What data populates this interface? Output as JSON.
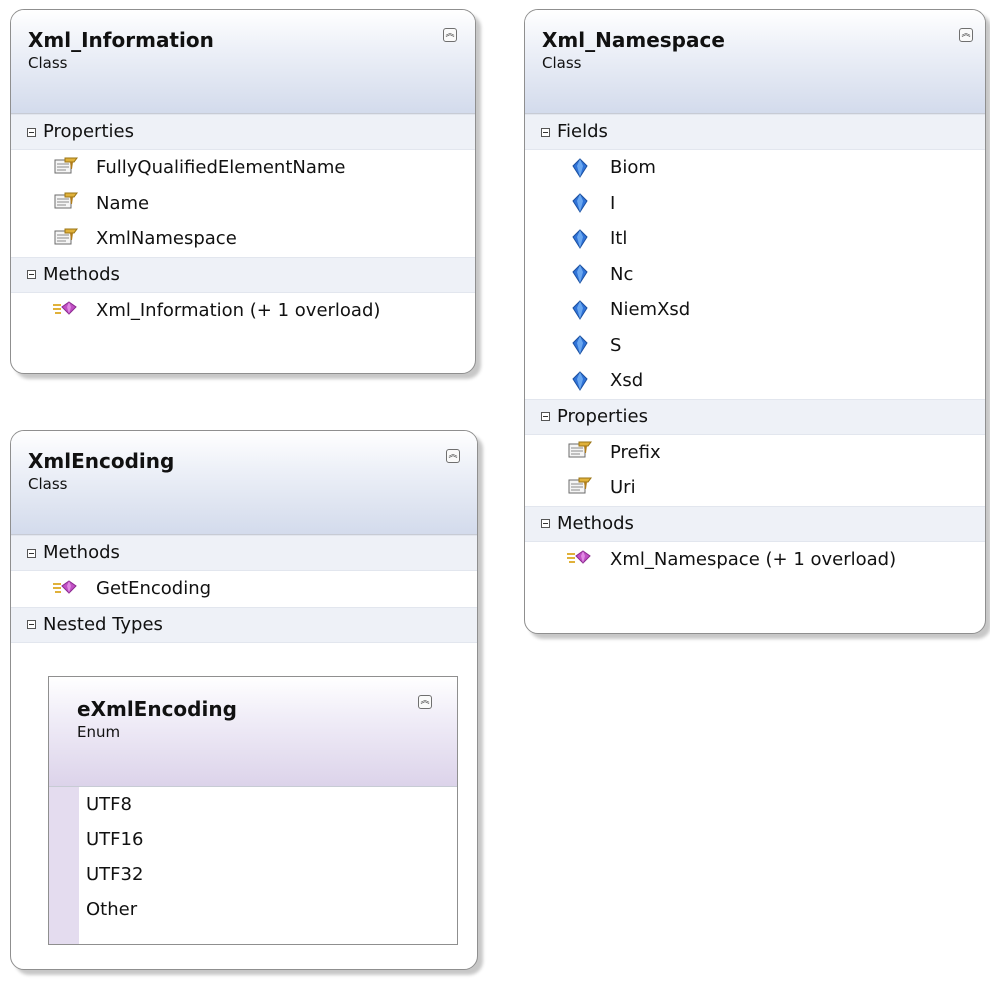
{
  "classes": {
    "xml_information": {
      "name": "Xml_Information",
      "stereotype": "Class",
      "sections": {
        "properties": {
          "label": "Properties",
          "items": [
            "FullyQualifiedElementName",
            "Name",
            "XmlNamespace"
          ]
        },
        "methods": {
          "label": "Methods",
          "items": [
            "Xml_Information (+ 1 overload)"
          ]
        }
      }
    },
    "xml_namespace": {
      "name": "Xml_Namespace",
      "stereotype": "Class",
      "sections": {
        "fields": {
          "label": "Fields",
          "items": [
            "Biom",
            "I",
            "Itl",
            "Nc",
            "NiemXsd",
            "S",
            "Xsd"
          ]
        },
        "properties": {
          "label": "Properties",
          "items": [
            "Prefix",
            "Uri"
          ]
        },
        "methods": {
          "label": "Methods",
          "items": [
            "Xml_Namespace (+ 1 overload)"
          ]
        }
      }
    },
    "xml_encoding": {
      "name": "XmlEncoding",
      "stereotype": "Class",
      "sections": {
        "methods": {
          "label": "Methods",
          "items": [
            "GetEncoding"
          ]
        },
        "nested_types": {
          "label": "Nested Types"
        }
      },
      "nested_enum": {
        "name": "eXmlEncoding",
        "stereotype": "Enum",
        "values": [
          "UTF8",
          "UTF16",
          "UTF32",
          "Other"
        ]
      }
    }
  },
  "icons": {
    "property": "property-icon",
    "field": "field-icon",
    "method": "method-icon",
    "collapse": "collapse-chevron-icon",
    "section_toggle": "minus-box-icon"
  },
  "colors": {
    "class_header_bottom": "#d3dbec",
    "enum_header_bottom": "#dcd3ea",
    "section_bg": "#eef1f7",
    "field_icon": "#2f73d8",
    "method_icon": "#c04fc4",
    "property_icon": "#e0b13a"
  }
}
